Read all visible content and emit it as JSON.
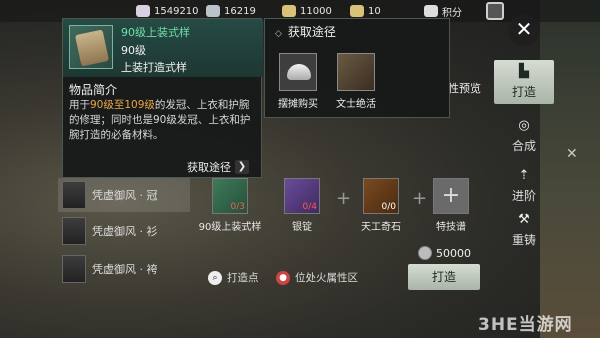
{
  "resources": [
    {
      "icon": "dumpling-icon",
      "value": "1549210"
    },
    {
      "icon": "silver-icon",
      "value": "16219"
    },
    {
      "icon": "ingot-icon",
      "value": "11000"
    },
    {
      "icon": "pouch-icon",
      "value": "10"
    },
    {
      "icon": "score-icon",
      "value": "积分"
    }
  ],
  "close_label": "✕",
  "item_popup": {
    "name": "90级上装式样",
    "level": "90级",
    "type": "上装打造式样",
    "desc_heading": "物品简介",
    "desc_parts": [
      "用于",
      "90级至109级",
      "的发冠、上衣和护腕的修理；同时也是90级发冠、上衣和护腕打造的必备材料。"
    ],
    "acquire_button": "获取途径"
  },
  "acquire_popup": {
    "title": "获取途径",
    "sources": [
      {
        "icon": "silver-ingot-icon",
        "label": "摆摊购买"
      },
      {
        "icon": "scholar-scroll-icon",
        "label": "文士绝活"
      }
    ]
  },
  "preview_label": "性预览",
  "side_tabs": [
    {
      "icon": "anvil-icon",
      "label": "打造",
      "active": true
    },
    {
      "icon": "combine-icon",
      "label": "合成"
    },
    {
      "icon": "upgrade-icon",
      "label": "进阶"
    },
    {
      "icon": "hammer-icon",
      "label": "重铸"
    }
  ],
  "equipment_list": [
    {
      "label": "凭虚御风 · 冠"
    },
    {
      "label": "凭虚御风 · 衫"
    },
    {
      "label": "凭虚御风 · 袴"
    }
  ],
  "materials": [
    {
      "name": "90级上装式样",
      "count": "0/3",
      "color": "green"
    },
    {
      "name": "银锭",
      "count": "0/4",
      "color": "purple"
    },
    {
      "name": "天工奇石",
      "count": "0/0",
      "color": "orange"
    },
    {
      "name": "特技谱",
      "count": "",
      "color": "grey"
    }
  ],
  "cost": "50000",
  "forge_button": "打造",
  "forge_point_link": "打造点",
  "fire_attr_link": "位处火属性区",
  "watermark": "3HE当游网"
}
